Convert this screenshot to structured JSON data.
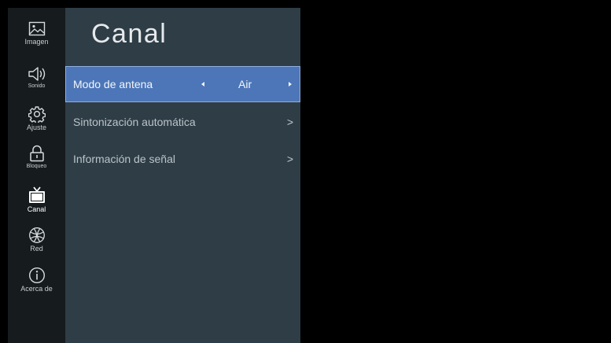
{
  "sidebar": {
    "items": [
      {
        "label": "Imagen",
        "icon": "image-icon",
        "active": false
      },
      {
        "label": "Sonido",
        "icon": "speaker-icon",
        "active": false
      },
      {
        "label": "Ajuste",
        "icon": "gear-icon",
        "active": false
      },
      {
        "label": "Bloqueo",
        "icon": "lock-icon",
        "active": false
      },
      {
        "label": "Canal",
        "icon": "tv-icon",
        "active": true
      },
      {
        "label": "Red",
        "icon": "globe-icon",
        "active": false
      },
      {
        "label": "Acerca de",
        "icon": "info-icon",
        "active": false
      }
    ]
  },
  "panel": {
    "title": "Canal",
    "rows": [
      {
        "label": "Modo de antena",
        "value": "Air",
        "left_arrow": "◂",
        "right_arrow": "▸",
        "selected": true
      },
      {
        "label": "Sintonización automática",
        "chevron": ">",
        "selected": false
      },
      {
        "label": "Información de señal",
        "chevron": ">",
        "selected": false
      }
    ]
  },
  "colors": {
    "sidebar_bg": "#161b1e",
    "panel_bg": "#2e3d46",
    "selected_row": "#4c76b8",
    "selected_border": "#8fb0e2",
    "background": "#000000"
  }
}
